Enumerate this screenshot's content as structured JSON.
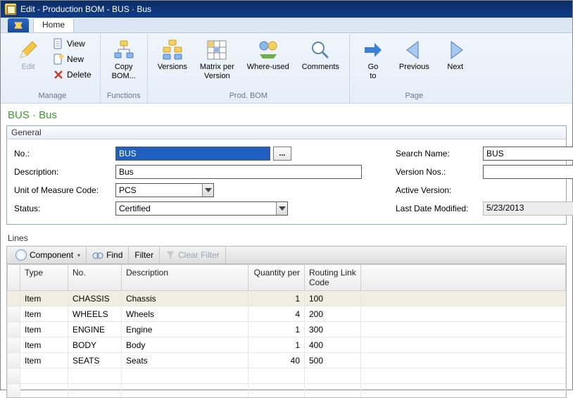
{
  "window": {
    "title": "Edit - Production BOM - BUS · Bus"
  },
  "tabs": {
    "home": "Home"
  },
  "ribbon": {
    "manage": {
      "caption": "Manage",
      "edit": "Edit",
      "view": "View",
      "new": "New",
      "delete": "Delete"
    },
    "functions": {
      "caption": "Functions",
      "copybom": "Copy\nBOM..."
    },
    "prodbom": {
      "caption": "Prod. BOM",
      "versions": "Versions",
      "matrix": "Matrix per\nVersion",
      "whereused": "Where-used",
      "comments": "Comments"
    },
    "page": {
      "caption": "Page",
      "goto": "Go\nto",
      "previous": "Previous",
      "next": "Next"
    }
  },
  "breadcrumb": "BUS · Bus",
  "general": {
    "heading": "General",
    "labels": {
      "no": "No.:",
      "description": "Description:",
      "uom": "Unit of Measure Code:",
      "status": "Status:",
      "searchname": "Search Name:",
      "versionnos": "Version Nos.:",
      "activeversion": "Active Version:",
      "lastmodified": "Last Date Modified:"
    },
    "values": {
      "no": "BUS",
      "description": "Bus",
      "uom": "PCS",
      "status": "Certified",
      "searchname": "BUS",
      "versionnos": "",
      "activeversion": "",
      "lastmodified": "5/23/2013"
    },
    "ellipsis": "..."
  },
  "lines": {
    "heading": "Lines",
    "toolbar": {
      "component": "Component",
      "find": "Find",
      "filter": "Filter",
      "clearfilter": "Clear Filter"
    },
    "columns": {
      "type": "Type",
      "no": "No.",
      "description": "Description",
      "qtyper": "Quantity per",
      "routing": "Routing Link Code"
    },
    "rows": [
      {
        "type": "Item",
        "no": "CHASSIS",
        "description": "Chassis",
        "qty": "1",
        "routing": "100"
      },
      {
        "type": "Item",
        "no": "WHEELS",
        "description": "Wheels",
        "qty": "4",
        "routing": "200"
      },
      {
        "type": "Item",
        "no": "ENGINE",
        "description": "Engine",
        "qty": "1",
        "routing": "300"
      },
      {
        "type": "Item",
        "no": "BODY",
        "description": "Body",
        "qty": "1",
        "routing": "400"
      },
      {
        "type": "Item",
        "no": "SEATS",
        "description": "Seats",
        "qty": "40",
        "routing": "500"
      }
    ]
  }
}
